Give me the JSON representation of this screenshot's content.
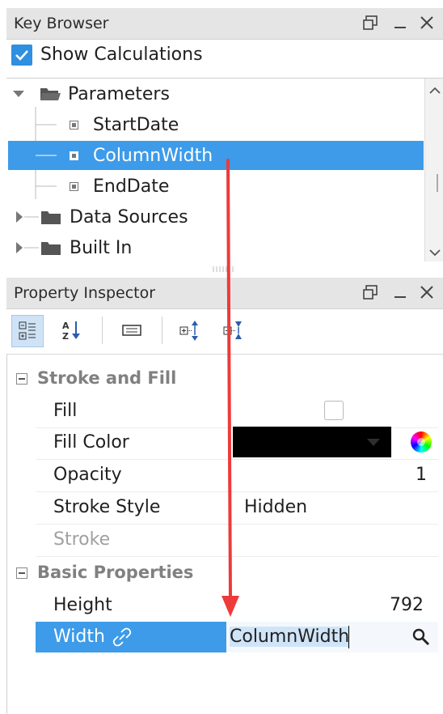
{
  "key_browser": {
    "title": "Key Browser",
    "show_calculations_label": "Show Calculations",
    "show_calculations_checked": true,
    "tree": {
      "parameters_label": "Parameters",
      "children": [
        "StartDate",
        "ColumnWidth",
        "EndDate"
      ],
      "data_sources_label": "Data Sources",
      "built_in_label": "Built In"
    },
    "scroll_up_icon": "chevron-up-icon",
    "scroll_down_icon": "chevron-down-icon"
  },
  "property_inspector": {
    "title": "Property Inspector",
    "toolbar_icons": [
      "categorized-view-icon",
      "sort-alpha-icon",
      "text-field-icon",
      "expand-all-icon",
      "collapse-all-icon"
    ],
    "sections": {
      "stroke_and_fill": {
        "title": "Stroke and Fill",
        "fill_label": "Fill",
        "fill_checked": false,
        "fill_color_label": "Fill Color",
        "fill_color_value": "#000000",
        "opacity_label": "Opacity",
        "opacity_value": "1",
        "stroke_style_label": "Stroke Style",
        "stroke_style_value": "Hidden",
        "stroke_label": "Stroke"
      },
      "basic_properties": {
        "title": "Basic Properties",
        "height_label": "Height",
        "height_value": "792",
        "width_label": "Width",
        "width_value": "ColumnWidth"
      }
    }
  },
  "colors": {
    "selection": "#3d9be9",
    "arrow": "#ee3a3a",
    "header_bg": "#e5e5e5",
    "checkbox_blue": "#2f8fe0"
  }
}
